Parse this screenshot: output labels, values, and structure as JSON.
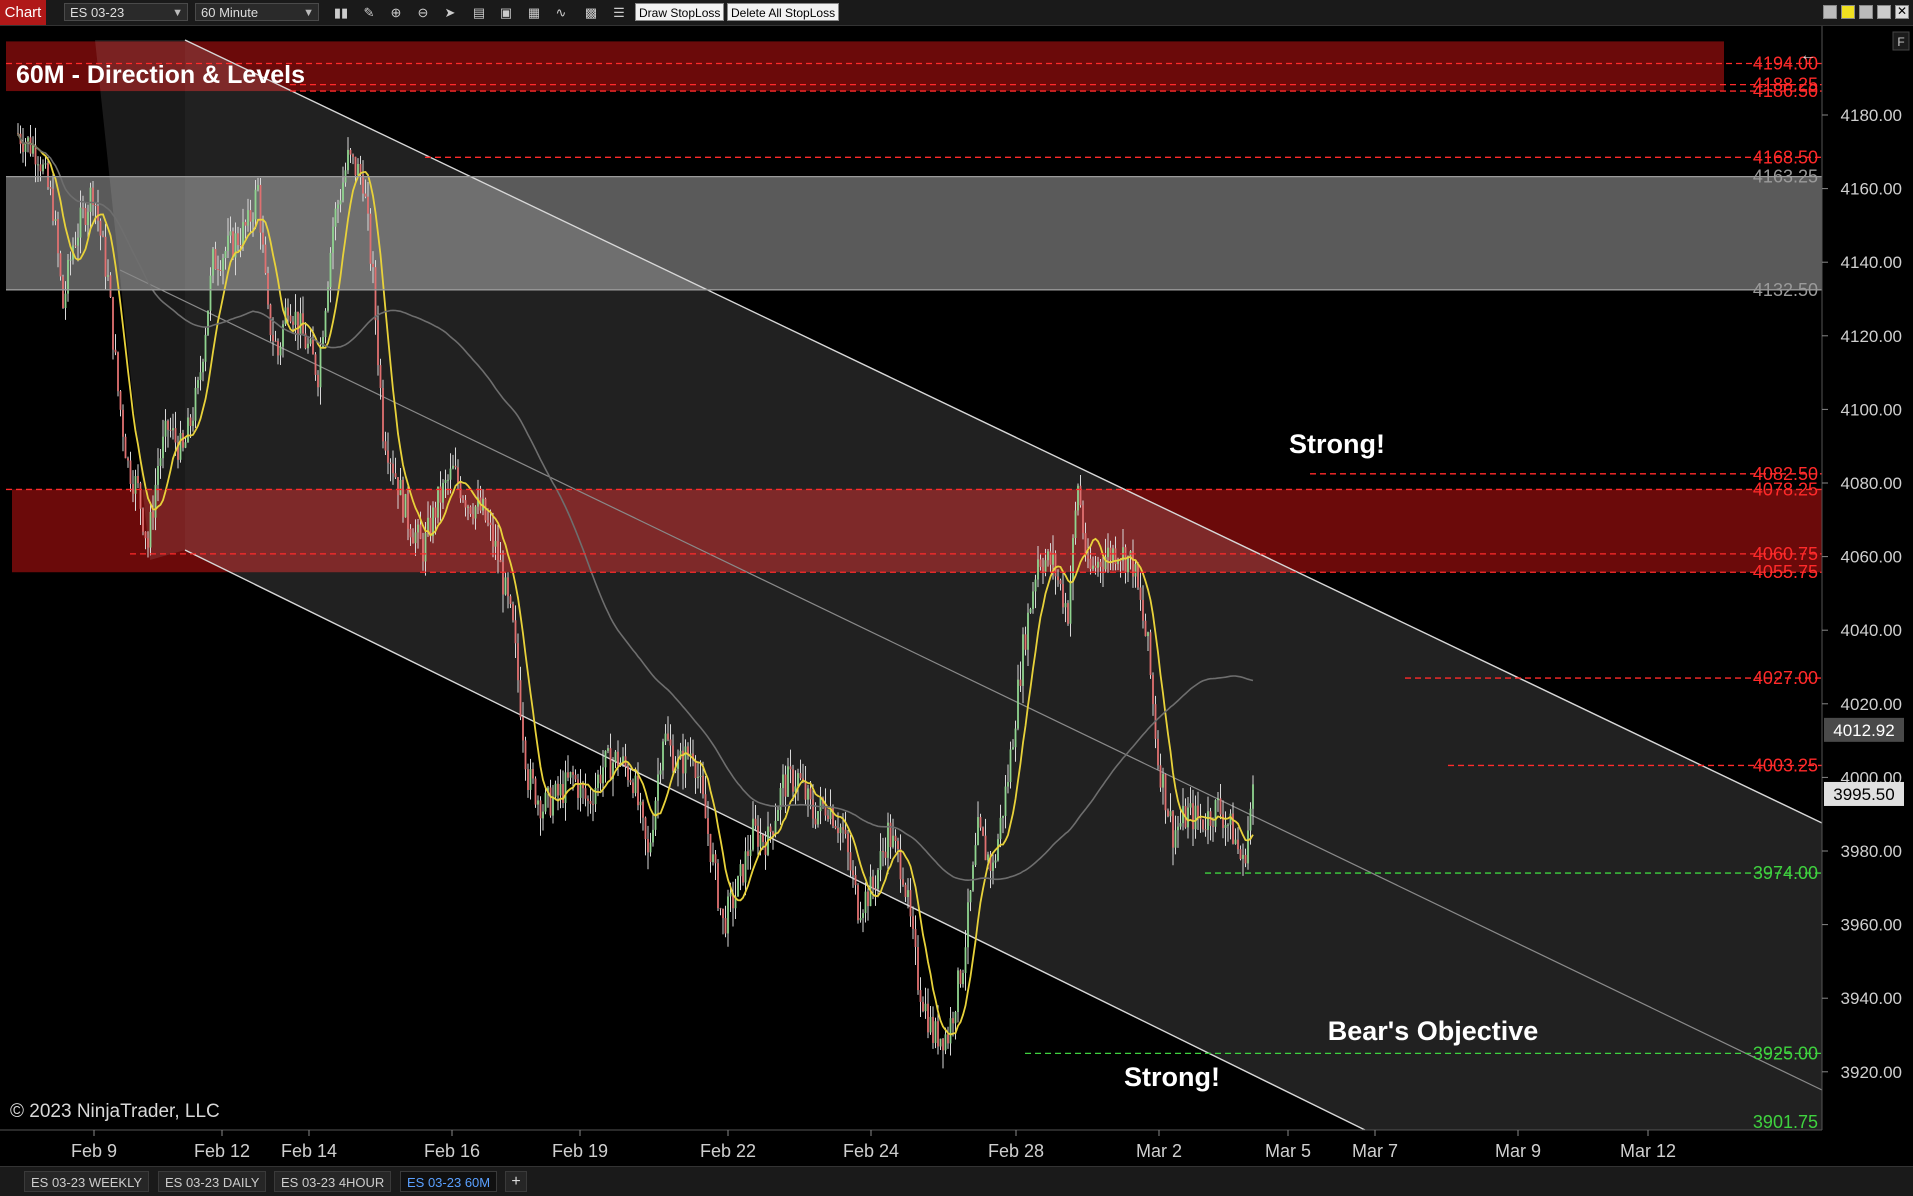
{
  "toolbar": {
    "chart_label": "Chart",
    "instrument": "ES 03-23",
    "interval": "60 Minute",
    "draw_stoploss": "Draw StopLoss",
    "delete_stoploss": "Delete All StopLoss"
  },
  "chart_data": {
    "type": "candlestick",
    "title": "60M - Direction & Levels",
    "copyright": "© 2023 NinjaTrader, LLC",
    "last_price": "3995.50",
    "last_price_value": 3995.5,
    "ma_label": "4012.92",
    "ma_label_value": 4012.92,
    "ylim": [
      3900,
      4200
    ],
    "y_ticks": [
      {
        "label": "4180.00",
        "v": 4180
      },
      {
        "label": "4160.00",
        "v": 4160
      },
      {
        "label": "4140.00",
        "v": 4140
      },
      {
        "label": "4120.00",
        "v": 4120
      },
      {
        "label": "4100.00",
        "v": 4100
      },
      {
        "label": "4080.00",
        "v": 4080
      },
      {
        "label": "4060.00",
        "v": 4060
      },
      {
        "label": "4040.00",
        "v": 4040
      },
      {
        "label": "4020.00",
        "v": 4020
      },
      {
        "label": "4000.00",
        "v": 4000
      },
      {
        "label": "3980.00",
        "v": 3980
      },
      {
        "label": "3960.00",
        "v": 3960
      },
      {
        "label": "3940.00",
        "v": 3940
      },
      {
        "label": "3920.00",
        "v": 3920
      }
    ],
    "x_ticks": [
      "Feb 9",
      "Feb 12",
      "Feb 14",
      "Feb 16",
      "Feb 19",
      "Feb 22",
      "Feb 24",
      "Feb 28",
      "Mar 2",
      "Mar 5",
      "Mar 7",
      "Mar 9",
      "Mar 12"
    ],
    "levels": [
      {
        "label": "4194.00",
        "v": 4194,
        "color": "#ff2a2a"
      },
      {
        "label": "4188.25",
        "v": 4188.25,
        "color": "#ff2a2a"
      },
      {
        "label": "4186.50",
        "v": 4186.5,
        "color": "#ff2a2a"
      },
      {
        "label": "4168.50",
        "v": 4168.5,
        "color": "#ff2a2a"
      },
      {
        "label": "4163.25",
        "v": 4163.25,
        "color": "#9a9a9a"
      },
      {
        "label": "4132.50",
        "v": 4132.5,
        "color": "#9a9a9a"
      },
      {
        "label": "4082.50",
        "v": 4082.5,
        "color": "#ff2a2a"
      },
      {
        "label": "4078.25",
        "v": 4078.25,
        "color": "#ff2a2a"
      },
      {
        "label": "4060.75",
        "v": 4060.75,
        "color": "#ff2a2a"
      },
      {
        "label": "4055.75",
        "v": 4055.75,
        "color": "#ff2a2a"
      },
      {
        "label": "4027.00",
        "v": 4027,
        "color": "#ff2a2a"
      },
      {
        "label": "4003.25",
        "v": 4003.25,
        "color": "#ff2a2a"
      },
      {
        "label": "3974.00",
        "v": 3974,
        "color": "#3fd23f"
      },
      {
        "label": "3925.00",
        "v": 3925,
        "color": "#3fd23f"
      },
      {
        "label": "3901.75",
        "v": 3901.75,
        "color": "#3fd23f"
      }
    ],
    "annotations": [
      "Strong!",
      "Strong!",
      "Bear's Objective"
    ],
    "colors": {
      "up": "#8fd48f",
      "down": "#e07070",
      "ma_fast": "#e8d23a",
      "ma_slow": "#6e6e6e",
      "resistance_zone": "#6b0a0a",
      "supply_zone": "#5a5a5a"
    },
    "series": [
      {
        "name": "Price",
        "points": [
          [
            0,
            4175
          ],
          [
            8,
            4170
          ],
          [
            14,
            4155
          ],
          [
            18,
            4128
          ],
          [
            22,
            4145
          ],
          [
            30,
            4160
          ],
          [
            36,
            4135
          ],
          [
            40,
            4105
          ],
          [
            44,
            4085
          ],
          [
            48,
            4078
          ],
          [
            52,
            4063
          ],
          [
            56,
            4085
          ],
          [
            60,
            4095
          ],
          [
            66,
            4088
          ],
          [
            72,
            4105
          ],
          [
            78,
            4140
          ],
          [
            86,
            4145
          ],
          [
            92,
            4150
          ],
          [
            96,
            4160
          ],
          [
            100,
            4125
          ],
          [
            104,
            4115
          ],
          [
            108,
            4130
          ],
          [
            114,
            4120
          ],
          [
            120,
            4110
          ],
          [
            126,
            4150
          ],
          [
            132,
            4168
          ],
          [
            138,
            4163
          ],
          [
            142,
            4135
          ],
          [
            146,
            4095
          ],
          [
            150,
            4085
          ],
          [
            156,
            4070
          ],
          [
            162,
            4062
          ],
          [
            168,
            4075
          ],
          [
            174,
            4083
          ],
          [
            180,
            4075
          ],
          [
            186,
            4072
          ],
          [
            192,
            4060
          ],
          [
            198,
            4040
          ],
          [
            204,
            4000
          ],
          [
            210,
            3992
          ],
          [
            216,
            3995
          ],
          [
            222,
            4000
          ],
          [
            228,
            3993
          ],
          [
            234,
            4003
          ],
          [
            240,
            4005
          ],
          [
            246,
            4000
          ],
          [
            252,
            3978
          ],
          [
            258,
            4012
          ],
          [
            264,
            4003
          ],
          [
            270,
            4008
          ],
          [
            276,
            3985
          ],
          [
            282,
            3960
          ],
          [
            288,
            3970
          ],
          [
            294,
            3985
          ],
          [
            300,
            3983
          ],
          [
            306,
            3998
          ],
          [
            312,
            4000
          ],
          [
            318,
            3990
          ],
          [
            324,
            3993
          ],
          [
            330,
            3985
          ],
          [
            336,
            3965
          ],
          [
            342,
            3970
          ],
          [
            348,
            3985
          ],
          [
            354,
            3975
          ],
          [
            360,
            3945
          ],
          [
            366,
            3930
          ],
          [
            372,
            3930
          ],
          [
            378,
            3950
          ],
          [
            384,
            3985
          ],
          [
            390,
            3975
          ],
          [
            396,
            4000
          ],
          [
            402,
            4035
          ],
          [
            408,
            4060
          ],
          [
            414,
            4058
          ],
          [
            420,
            4045
          ],
          [
            424,
            4080
          ],
          [
            428,
            4055
          ],
          [
            434,
            4060
          ],
          [
            440,
            4062
          ],
          [
            446,
            4058
          ],
          [
            452,
            4035
          ],
          [
            456,
            4005
          ],
          [
            462,
            3985
          ],
          [
            468,
            3990
          ],
          [
            474,
            3988
          ],
          [
            480,
            3992
          ],
          [
            486,
            3985
          ],
          [
            490,
            3976
          ],
          [
            494,
            3995.5
          ]
        ]
      }
    ]
  }
}
